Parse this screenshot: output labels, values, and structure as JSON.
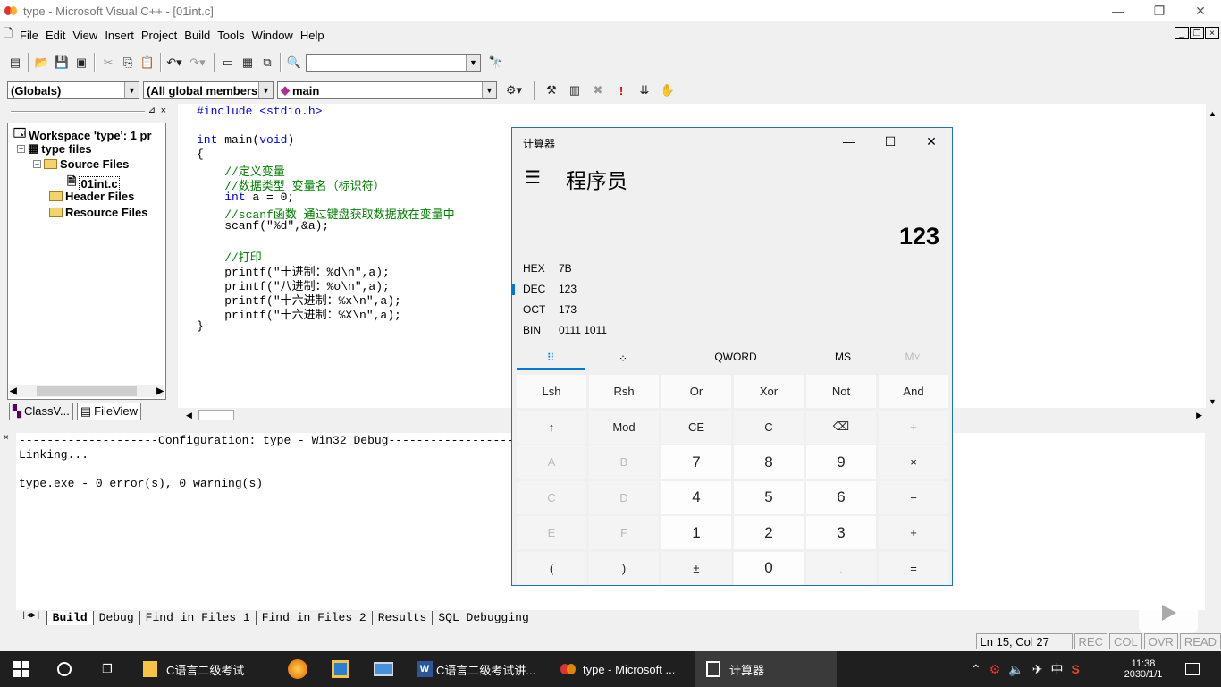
{
  "window": {
    "title": "type - Microsoft Visual C++ - [01int.c]",
    "minimize": "—",
    "maximize": "❐",
    "close": "✕"
  },
  "menu": [
    "File",
    "Edit",
    "View",
    "Insert",
    "Project",
    "Build",
    "Tools",
    "Window",
    "Help"
  ],
  "mdi": [
    "_",
    "❐",
    "×"
  ],
  "wizard": {
    "scope": "(Globals)",
    "members": "(All global members",
    "function": "main"
  },
  "workspace": {
    "root": "Workspace 'type': 1 pr",
    "project": "type files",
    "source": "Source Files",
    "file": "01int.c",
    "header": "Header Files",
    "resource": "Resource Files",
    "tabs": [
      "ClassV...",
      "FileView"
    ]
  },
  "code": [
    {
      "parts": [
        {
          "t": "#include <stdio.h>",
          "c": "kw"
        }
      ]
    },
    {
      "parts": []
    },
    {
      "parts": [
        {
          "t": "int",
          "c": "kw"
        },
        {
          "t": " main(",
          "c": ""
        },
        {
          "t": "void",
          "c": "kw"
        },
        {
          "t": ")",
          "c": ""
        }
      ]
    },
    {
      "parts": [
        {
          "t": "{",
          "c": ""
        }
      ]
    },
    {
      "parts": [
        {
          "t": "    //定义变量",
          "c": "cm"
        }
      ]
    },
    {
      "parts": [
        {
          "t": "    //数据类型 变量名（标识符）",
          "c": "cm"
        }
      ]
    },
    {
      "parts": [
        {
          "t": "    ",
          "c": ""
        },
        {
          "t": "int",
          "c": "kw"
        },
        {
          "t": " a = 0;",
          "c": ""
        }
      ]
    },
    {
      "parts": [
        {
          "t": "    //scanf函数 通过键盘获取数据放在变量中",
          "c": "cm"
        }
      ]
    },
    {
      "parts": [
        {
          "t": "    scanf(\"%d\",&a);",
          "c": ""
        }
      ]
    },
    {
      "parts": []
    },
    {
      "parts": [
        {
          "t": "    //打印",
          "c": "cm"
        }
      ]
    },
    {
      "parts": [
        {
          "t": "    printf(\"十进制：%d\\n\",a);",
          "c": ""
        }
      ]
    },
    {
      "parts": [
        {
          "t": "    printf(\"八进制：%o\\n\",a);",
          "c": ""
        }
      ]
    },
    {
      "parts": [
        {
          "t": "    printf(\"十六进制：%x\\n\",a);",
          "c": ""
        }
      ]
    },
    {
      "parts": [
        {
          "t": "    printf(\"十六进制：%X\\n\",a);",
          "c": ""
        }
      ]
    },
    {
      "parts": [
        {
          "t": "}",
          "c": ""
        }
      ]
    }
  ],
  "output": {
    "lines": [
      "--------------------Configuration: type - Win32 Debug--------------------",
      "Linking...",
      "",
      "type.exe - 0 error(s), 0 warning(s)"
    ],
    "tabs": [
      "Build",
      "Debug",
      "Find in Files 1",
      "Find in Files 2",
      "Results",
      "SQL Debugging"
    ]
  },
  "status": {
    "position": "Ln 15, Col 27",
    "indicators": [
      "REC",
      "COL",
      "OVR",
      "READ"
    ]
  },
  "calc": {
    "title": "计算器",
    "mode": "程序员",
    "display": "123",
    "radix": [
      {
        "label": "HEX",
        "value": "7B"
      },
      {
        "label": "DEC",
        "value": "123"
      },
      {
        "label": "OCT",
        "value": "173"
      },
      {
        "label": "BIN",
        "value": "0111 1011"
      }
    ],
    "bar": {
      "word": "QWORD",
      "ms": "MS",
      "mv": "M˅"
    },
    "keys": [
      [
        "Lsh",
        "Rsh",
        "Or",
        "Xor",
        "Not",
        "And"
      ],
      [
        "↑",
        "Mod",
        "CE",
        "C",
        "⌫",
        "÷"
      ],
      [
        "A",
        "B",
        "7",
        "8",
        "9",
        "×"
      ],
      [
        "C",
        "D",
        "4",
        "5",
        "6",
        "−"
      ],
      [
        "E",
        "F",
        "1",
        "2",
        "3",
        "+"
      ],
      [
        "(",
        ")",
        "±",
        "0",
        ".",
        "="
      ]
    ]
  },
  "taskbar": {
    "apps": [
      {
        "label": "C语言二级考试"
      },
      {
        "label": ""
      },
      {
        "label": ""
      },
      {
        "label": ""
      },
      {
        "label": "C语言二级考试讲..."
      },
      {
        "label": "type - Microsoft ..."
      },
      {
        "label": "计算器"
      }
    ],
    "tray": {
      "ime": "中",
      "time": "11:38",
      "date": "2030/1/1"
    }
  },
  "colors": {
    "accent": "#0078d7",
    "keyword": "#0000ff",
    "comment": "#008000"
  }
}
